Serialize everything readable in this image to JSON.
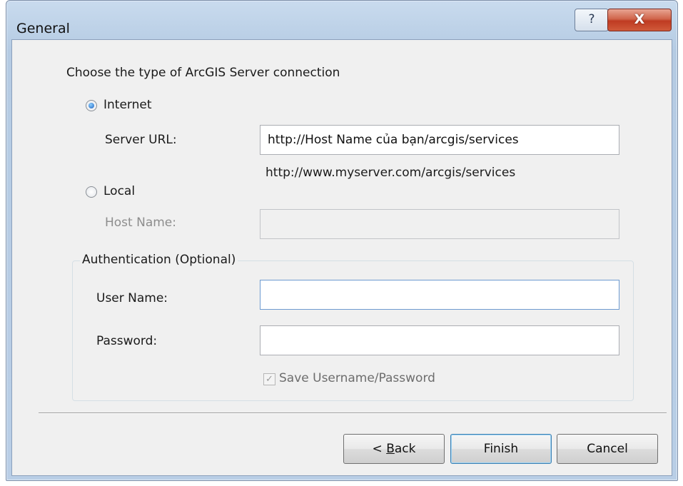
{
  "window": {
    "title": "General",
    "help_glyph": "?",
    "close_glyph": "X"
  },
  "prompt": "Choose the type of ArcGIS Server connection",
  "internet": {
    "label": "Internet",
    "selected": true,
    "server_url_label": "Server URL:",
    "server_url_value": "http://Host Name của bạn/arcgis/services",
    "server_url_hint": "http://www.myserver.com/arcgis/services"
  },
  "local": {
    "label": "Local",
    "selected": false,
    "host_name_label": "Host Name:",
    "host_name_value": ""
  },
  "auth": {
    "group_label": "Authentication (Optional)",
    "user_name_label": "User Name:",
    "user_name_value": "",
    "password_label": "Password:",
    "password_value": "",
    "save_label": "Save Username/Password",
    "save_checked": true
  },
  "buttons": {
    "back_prefix": "< ",
    "back_mnemonic": "B",
    "back_rest": "ack",
    "finish": "Finish",
    "cancel": "Cancel"
  },
  "colors": {
    "title_bar": "#b9cee6",
    "close_button": "#c8452b",
    "dialog_bg": "#f0f0f0"
  }
}
